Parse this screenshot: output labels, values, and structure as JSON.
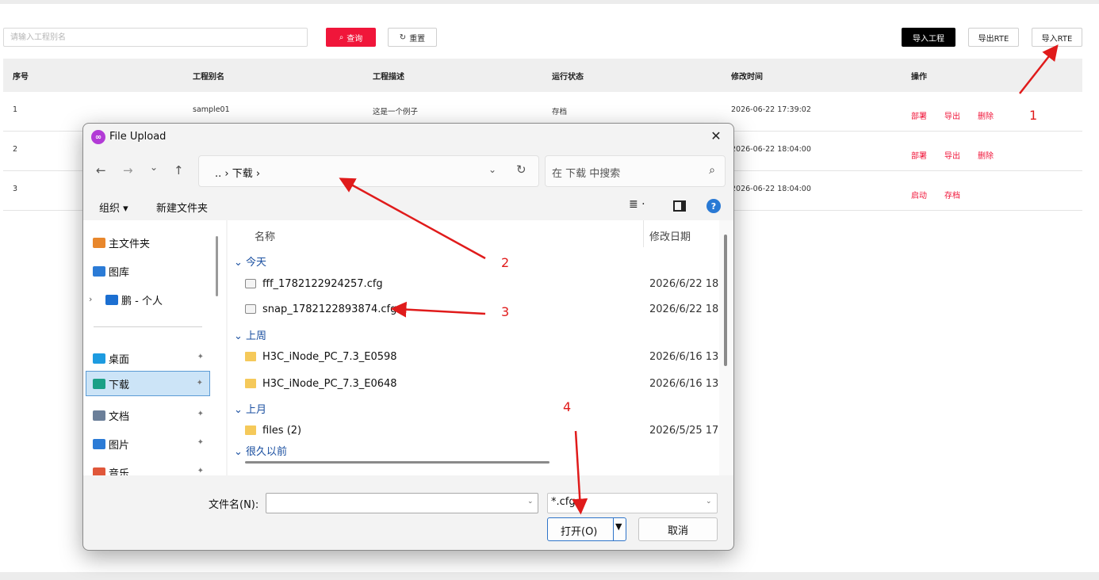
{
  "toolbar": {
    "search_placeholder": "请输入工程别名",
    "query_label": "查询",
    "query_icon": "search-icon",
    "reset_label": "重置",
    "reset_icon": "refresh-icon",
    "import_project_label": "导入工程",
    "export_rte_label": "导出RTE",
    "import_rte_label": "导入RTE"
  },
  "table": {
    "headers": [
      "序号",
      "工程别名",
      "工程描述",
      "运行状态",
      "修改时间",
      "操作"
    ],
    "rows": [
      {
        "index": "1",
        "alias": "sample01",
        "desc": "这是一个例子",
        "status": "存档",
        "modified": "2026-06-22 17:39:02",
        "ops": [
          "部署",
          "导出",
          "删除"
        ]
      },
      {
        "index": "2",
        "alias": "",
        "desc": "",
        "status": "",
        "modified": "2026-06-22 18:04:00",
        "ops": [
          "部署",
          "导出",
          "删除"
        ]
      },
      {
        "index": "3",
        "alias": "",
        "desc": "",
        "status": "",
        "modified": "2026-06-22 18:04:00",
        "ops": [
          "启动",
          "存档"
        ]
      }
    ]
  },
  "dialog": {
    "title": "File Upload",
    "close_glyph": "✕",
    "nav": {
      "back": "←",
      "forward": "→",
      "recent": "⌄",
      "up": "↑"
    },
    "address": ".. › 下载 ›",
    "search_placeholder": "在 下载 中搜索",
    "commands": {
      "organize": "组织 ▾",
      "new_folder": "新建文件夹",
      "view": "≣ ·",
      "help": "?"
    },
    "sidebar": [
      {
        "label": "主文件夹",
        "icon": "home-icon",
        "color": "#e8872c"
      },
      {
        "label": "图库",
        "icon": "gallery-icon",
        "color": "#2b7bd6"
      },
      {
        "label": "鹏 - 个人",
        "icon": "cloud-icon",
        "color": "#1c6fd1"
      },
      {
        "label": "桌面",
        "icon": "desktop-icon",
        "color": "#1d9be0"
      },
      {
        "label": "下载",
        "icon": "download-icon",
        "color": "#1aa086"
      },
      {
        "label": "文档",
        "icon": "document-icon",
        "color": "#6b7f99"
      },
      {
        "label": "图片",
        "icon": "pictures-icon",
        "color": "#2b7bd6"
      },
      {
        "label": "音乐",
        "icon": "music-icon",
        "color": "#e0573a"
      }
    ],
    "columns": {
      "name": "名称",
      "date": "修改日期"
    },
    "groups": [
      {
        "label": "今天",
        "files": [
          {
            "name": "fff_1782122924257.cfg",
            "date": "2026/6/22 18:",
            "type": "cfg"
          },
          {
            "name": "snap_1782122893874.cfg",
            "date": "2026/6/22 18:",
            "type": "cfg"
          }
        ]
      },
      {
        "label": "上周",
        "files": [
          {
            "name": "H3C_iNode_PC_7.3_E0598",
            "date": "2026/6/16 13:",
            "type": "folder"
          },
          {
            "name": "H3C_iNode_PC_7.3_E0648",
            "date": "2026/6/16 13:",
            "type": "folder"
          }
        ]
      },
      {
        "label": "上月",
        "files": [
          {
            "name": "files (2)",
            "date": "2026/5/25 17:",
            "type": "folder"
          }
        ]
      },
      {
        "label": "很久以前",
        "files": []
      }
    ],
    "filename_label": "文件名(N):",
    "filename_value": "",
    "filter_value": "*.cfg",
    "open_label": "打开(O)",
    "cancel_label": "取消"
  },
  "annotations": [
    "1",
    "2",
    "3",
    "4"
  ],
  "colors": {
    "accent": "#f0163a",
    "annotation": "#e01b1b",
    "dialog_bg": "#f3f3f3",
    "link_blue": "#1a4fa0"
  }
}
